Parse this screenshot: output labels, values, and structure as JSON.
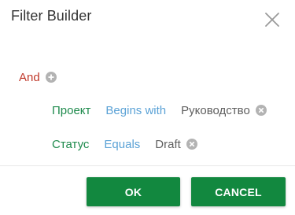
{
  "dialog": {
    "title": "Filter Builder",
    "close_icon": "close-icon"
  },
  "group": {
    "operator": "And",
    "add_icon": "plus-circle-icon"
  },
  "conditions": [
    {
      "field": "Проект",
      "operation": "Begins with",
      "value": "Руководство",
      "remove_icon": "remove-circle-icon"
    },
    {
      "field": "Статус",
      "operation": "Equals",
      "value": "Draft",
      "remove_icon": "remove-circle-icon"
    }
  ],
  "buttons": {
    "ok_label": "OK",
    "cancel_label": "CANCEL"
  },
  "colors": {
    "group_operator": "#c0392b",
    "field": "#1e8a4c",
    "operation": "#5ba2d6",
    "value": "#5f5f5f",
    "button_bg": "#12883f",
    "icon_gray": "#b3b3b3"
  }
}
